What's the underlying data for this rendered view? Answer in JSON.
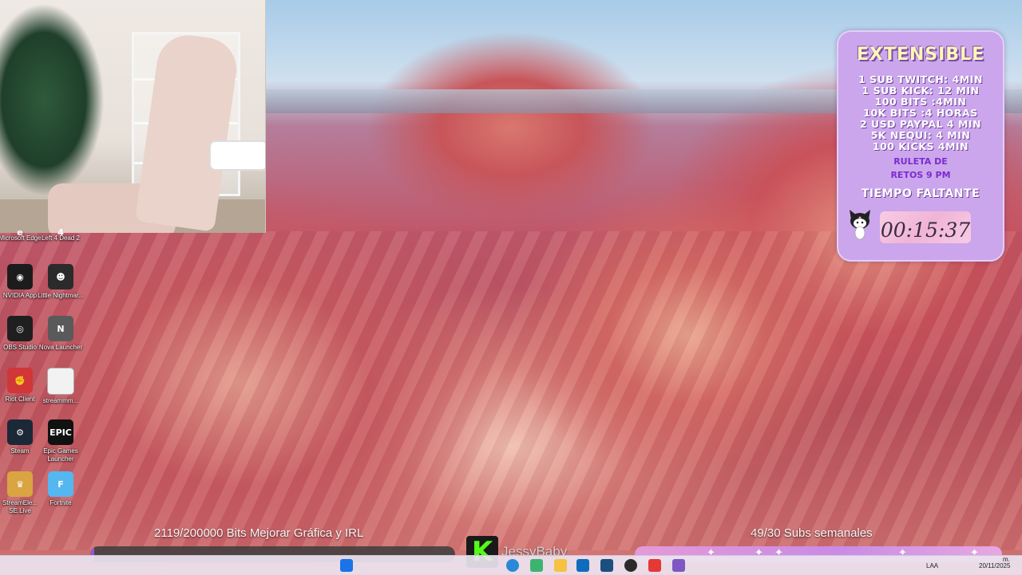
{
  "panel": {
    "title": "EXTENSIBLE",
    "rates": [
      "1 SUB TWITCH: 4MIN",
      "1 SUB KICK: 12 MIN",
      "100 BITS :4MIN",
      "10K BITS :4 HORAS",
      "2 USD PAYPAL 4 MIN",
      "5K NEQUI: 4 MIN",
      "100 KICKS 4MIN"
    ],
    "ruleta_line1": "RULETA DE",
    "ruleta_line2": "RETOS 9 PM",
    "timer_title": "TIEMPO FALTANTE",
    "timer": "00:15:37"
  },
  "desktop_icons": [
    {
      "label": "Microsoft Edge",
      "icon": "edge-icon",
      "color": "#1a73c8",
      "glyph": "e"
    },
    {
      "label": "Left 4 Dead 2",
      "icon": "game-icon",
      "color": "#3a3a3a",
      "glyph": "4"
    },
    {
      "label": "NVIDIA App",
      "icon": "nvidia-icon",
      "color": "#1c1c1c",
      "glyph": "◉"
    },
    {
      "label": "Little Nightmar...",
      "icon": "game-icon",
      "color": "#2b2b2b",
      "glyph": "☻"
    },
    {
      "label": "OBS Studio",
      "icon": "obs-icon",
      "color": "#1f1f1f",
      "glyph": "◎"
    },
    {
      "label": "Nova Launcher",
      "icon": "launcher-icon",
      "color": "#5a5a5a",
      "glyph": "N"
    },
    {
      "label": "Riot Client",
      "icon": "riot-icon",
      "color": "#d13639",
      "glyph": "✊"
    },
    {
      "label": "streammm...",
      "icon": "file-icon",
      "color": "#f2f2f2",
      "glyph": ""
    },
    {
      "label": "Steam",
      "icon": "steam-icon",
      "color": "#1b2838",
      "glyph": "⚙"
    },
    {
      "label": "Epic Games Launcher",
      "icon": "epic-icon",
      "color": "#111111",
      "glyph": "EPIC"
    },
    {
      "label": "StreamEle... SE.Live",
      "icon": "crown-icon",
      "color": "#d9a441",
      "glyph": "♛"
    },
    {
      "label": "Fortnite",
      "icon": "fortnite-icon",
      "color": "#54b7f0",
      "glyph": "F"
    }
  ],
  "overlay": {
    "bits_goal": "2119/200000 Bits Mejorar Gráfica y IRL",
    "bits_progress": 0.0106,
    "subs_goal": "49/30 Subs semanales",
    "kick_letter": "K",
    "channel_name": "JessyBaby"
  },
  "taskbar": {
    "lang": "LAA",
    "date": "20/11/2025",
    "time": "m."
  },
  "colors": {
    "panel_bg": "#cba6ec",
    "kick_green": "#53fc18",
    "timer_bg": "#f0b4d6"
  }
}
